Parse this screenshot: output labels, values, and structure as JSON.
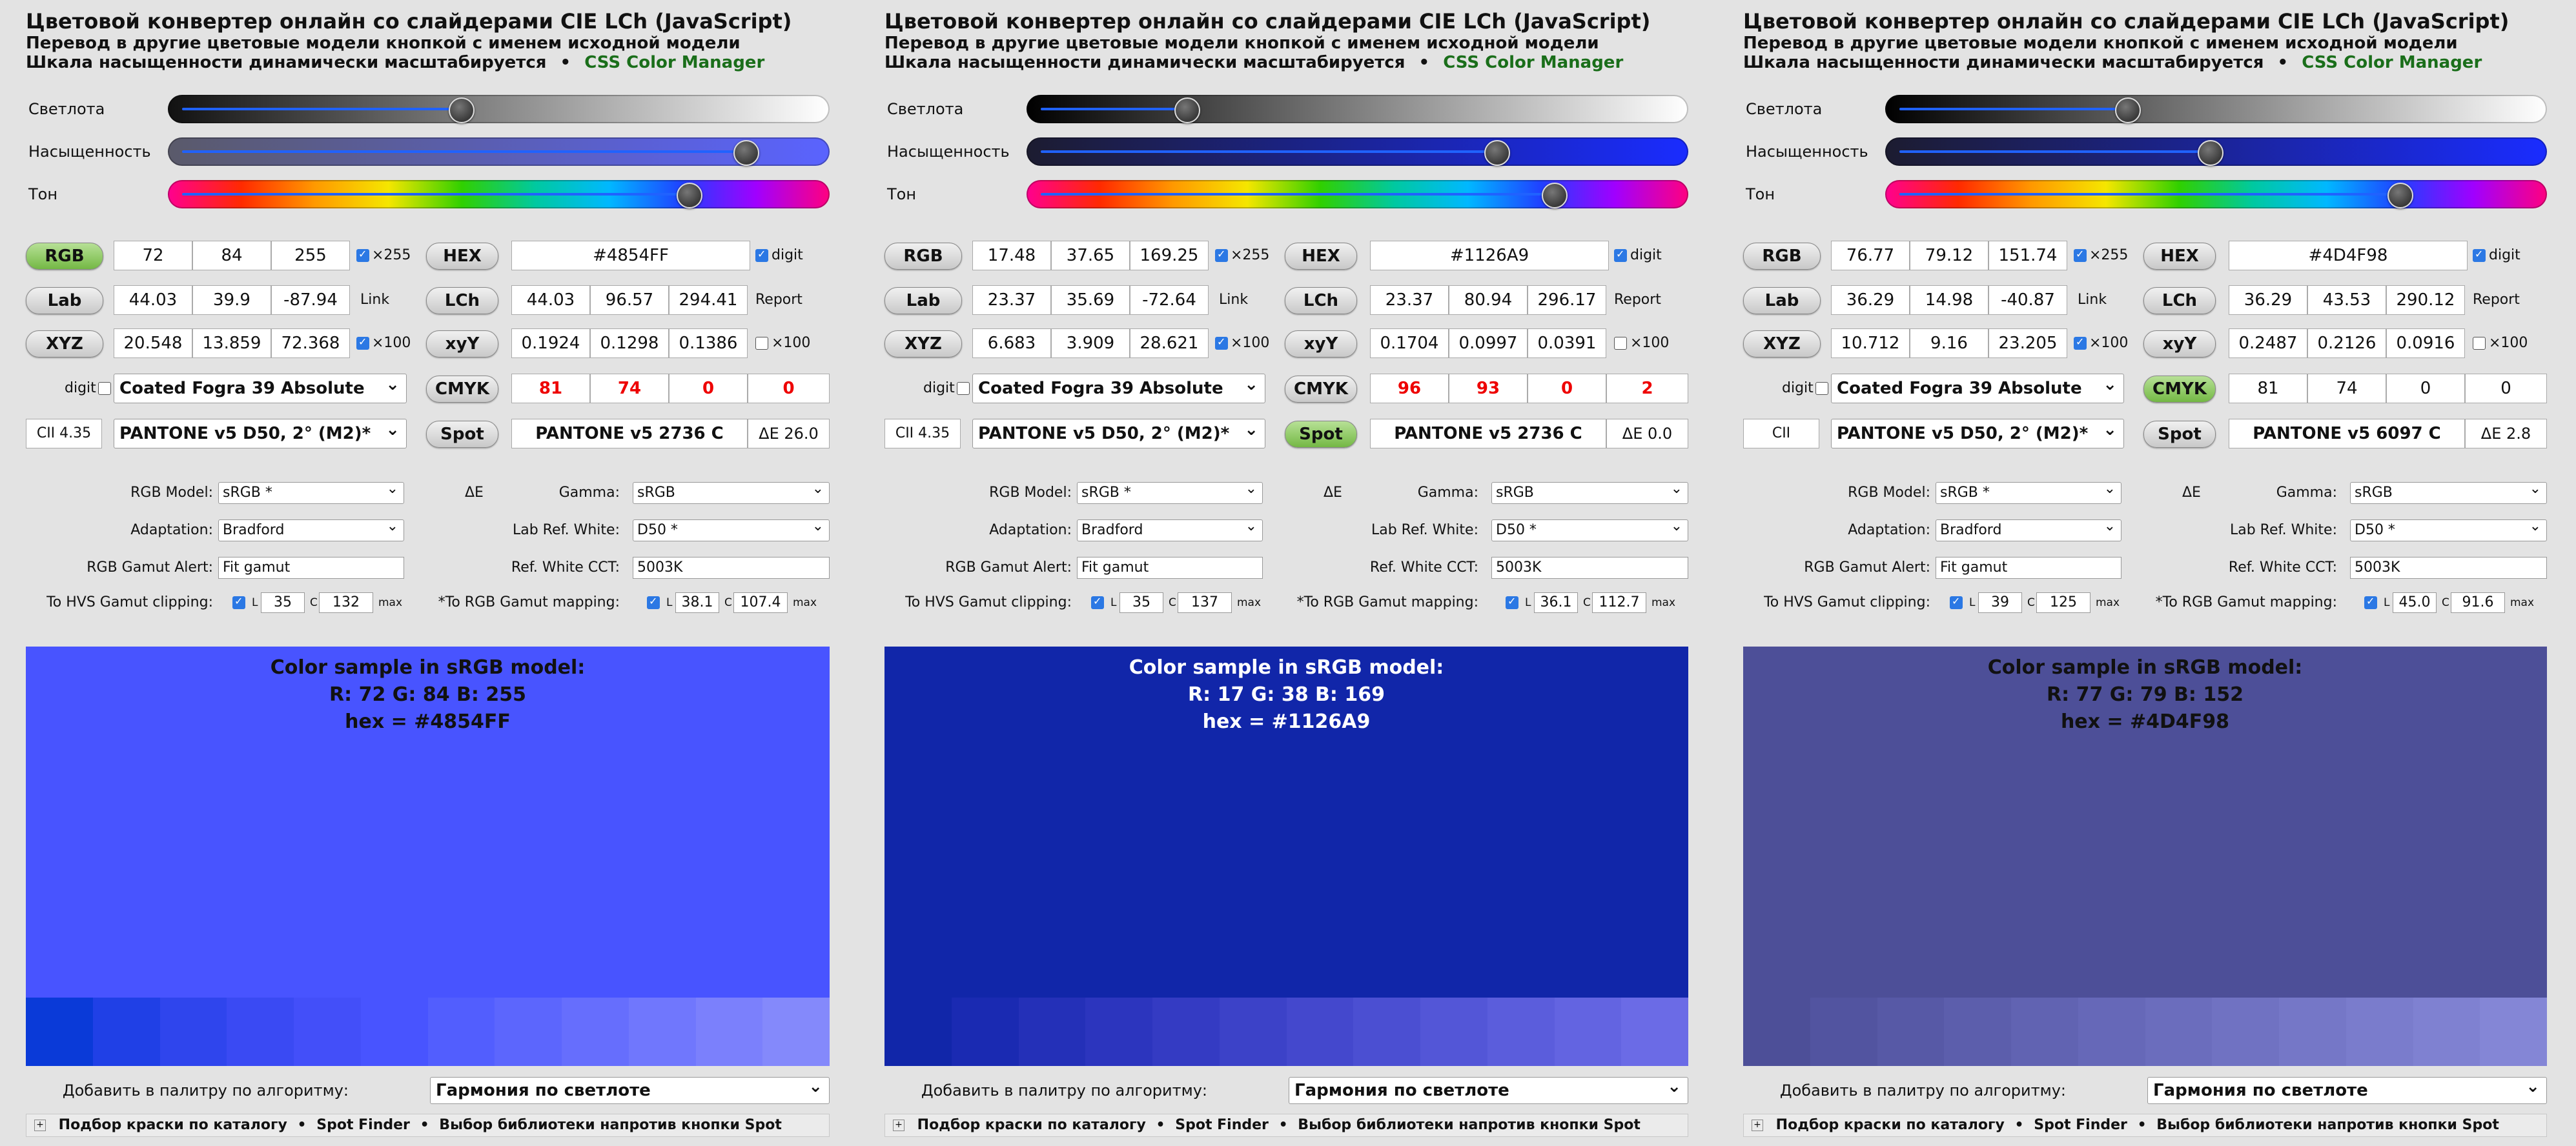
{
  "common": {
    "title": "Цветовой конвертер онлайн со слайдерами CIE LCh (JavaScript)",
    "subtitle": "Перевод в другие цветовые модели кнопкой с именем исходной модели",
    "subtitle2": "Шкала насыщенности динамически масштабируется",
    "bullet": "•",
    "css_link": "CSS Color Manager",
    "slider_lightness": "Светлота",
    "slider_chroma": "Насыщенность",
    "slider_hue": "Тон",
    "btn_rgb": "RGB",
    "btn_hex": "HEX",
    "btn_lab": "Lab",
    "btn_lch": "LCh",
    "btn_xyz": "XYZ",
    "btn_xyy": "xyY",
    "btn_cmyk": "CMYK",
    "btn_spot": "Spot",
    "x255": "×255",
    "digit": "digit",
    "link": "Link",
    "report": "Report",
    "x100": "×100",
    "cmyk_profile": "Coated Fogra 39 Absolute",
    "spot_library": "PANTONE v5   D50, 2° (M2)*",
    "lbl_rgb_model": "RGB Model:",
    "lbl_delta_e": "ΔE",
    "lbl_gamma": "Gamma:",
    "lbl_adaptation": "Adaptation:",
    "lbl_lab_white": "Lab Ref. White:",
    "lbl_gamut_alert": "RGB Gamut Alert:",
    "lbl_white_cct": "Ref. White CCT:",
    "lbl_hvs": "To HVS Gamut clipping:",
    "lbl_rgb_map": "*To RGB Gamut mapping:",
    "lbl_L": "L",
    "lbl_C": "C",
    "lbl_max": "max",
    "val_rgb_model": "sRGB *",
    "val_gamma": "sRGB",
    "val_adaptation": "Bradford",
    "val_lab_white": "D50 *",
    "val_gamut_alert": "Fit gamut",
    "val_white_cct": "5003K",
    "sample_title": "Color sample in sRGB model:",
    "add_palette_label": "Добавить в палитру по алгоритму:",
    "add_palette_value": "Гармония по светлоте",
    "footer_1": "Подбор краски по каталогу",
    "footer_2": "Spot Finder",
    "footer_3": "Выбор библиотеки напротив кнопки Spot",
    "footer_sep": "•",
    "footer_plus": "+"
  },
  "panels": [
    {
      "rgb": [
        "72",
        "84",
        "255"
      ],
      "hex": "#4854FF",
      "lab": [
        "44.03",
        "39.9",
        "-87.94"
      ],
      "lch": [
        "44.03",
        "96.57",
        "294.41"
      ],
      "xyz": [
        "20.548",
        "13.859",
        "72.368"
      ],
      "xyy": [
        "0.1924",
        "0.1298",
        "0.1386"
      ],
      "cmyk": [
        "81",
        "74",
        "0",
        "0"
      ],
      "cmyk_red": true,
      "cmyk_active": false,
      "cii": "CII 4.35",
      "spot_name": "PANTONE v5 2736 C",
      "spot_de": "ΔE 26.0",
      "spot_active": false,
      "hvs_L": "35",
      "hvs_C": "132",
      "map_L": "38.1",
      "map_C": "107.4",
      "sample_rgb": "R: 72   G: 84   B: 255",
      "sample_hex": "hex = #4854FF",
      "color": "#4854FF",
      "text_color": "#111111",
      "strip": [
        "#0a3ad8",
        "#2040e6",
        "#2f45ed",
        "#3a4af3",
        "#434ff9",
        "#4854ff",
        "#525efe",
        "#5c66fd",
        "#666efd",
        "#7077fd",
        "#7b80fc",
        "#8489fb"
      ],
      "slider_L": 0.44,
      "slider_C": 0.89,
      "slider_H": 0.8,
      "track_L": [
        "#111",
        "#fff"
      ],
      "track_C": [
        "#5a5a6a",
        "#5a63ff"
      ]
    },
    {
      "rgb": [
        "17.48",
        "37.65",
        "169.25"
      ],
      "hex": "#1126A9",
      "lab": [
        "23.37",
        "35.69",
        "-72.64"
      ],
      "lch": [
        "23.37",
        "80.94",
        "296.17"
      ],
      "xyz": [
        "6.683",
        "3.909",
        "28.621"
      ],
      "xyy": [
        "0.1704",
        "0.0997",
        "0.0391"
      ],
      "cmyk": [
        "96",
        "93",
        "0",
        "2"
      ],
      "cmyk_red": true,
      "cmyk_active": false,
      "cii": "CII 4.35",
      "spot_name": "PANTONE v5 2736 C",
      "spot_de": "ΔE 0.0",
      "spot_active": true,
      "hvs_L": "35",
      "hvs_C": "137",
      "map_L": "36.1",
      "map_C": "112.7",
      "sample_rgb": "R: 17   G: 38   B: 169",
      "sample_hex": "hex = #1126A9",
      "color": "#1126A9",
      "text_color": "#ffffff",
      "strip": [
        "#1126a9",
        "#1a2ab2",
        "#2430b8",
        "#2c35be",
        "#343bc3",
        "#3c42c8",
        "#4448cd",
        "#4b4fd2",
        "#5356d7",
        "#5b5ddc",
        "#6364e1",
        "#6b6be6"
      ],
      "slider_L": 0.23,
      "slider_C": 0.72,
      "slider_H": 0.81,
      "track_L": [
        "#000",
        "#fff"
      ],
      "track_C": [
        "#1c1c30",
        "#1a2cff"
      ]
    },
    {
      "rgb": [
        "76.77",
        "79.12",
        "151.74"
      ],
      "hex": "#4D4F98",
      "lab": [
        "36.29",
        "14.98",
        "-40.87"
      ],
      "lch": [
        "36.29",
        "43.53",
        "290.12"
      ],
      "xyz": [
        "10.712",
        "9.16",
        "23.205"
      ],
      "xyy": [
        "0.2487",
        "0.2126",
        "0.0916"
      ],
      "cmyk": [
        "81",
        "74",
        "0",
        "0"
      ],
      "cmyk_red": false,
      "cmyk_active": true,
      "cii": "CII",
      "spot_name": "PANTONE v5 6097 C",
      "spot_de": "ΔE 2.8",
      "spot_active": false,
      "hvs_L": "39",
      "hvs_C": "125",
      "map_L": "45.0",
      "map_C": "91.6",
      "sample_rgb": "R: 77   G: 79   B: 152",
      "sample_hex": "hex = #4D4F98",
      "color": "#4D4F98",
      "text_color": "#111111",
      "strip": [
        "#4d4f98",
        "#5254a0",
        "#5759a6",
        "#5c5eac",
        "#6163b2",
        "#6668b8",
        "#6b6dbd",
        "#7072c2",
        "#7577c7",
        "#7a7ccc",
        "#7f81d1",
        "#8486d6"
      ],
      "slider_L": 0.36,
      "slider_C": 0.49,
      "slider_H": 0.79,
      "track_L": [
        "#000",
        "#fff"
      ],
      "track_C": [
        "#1c1c30",
        "#1a2cff"
      ]
    }
  ]
}
